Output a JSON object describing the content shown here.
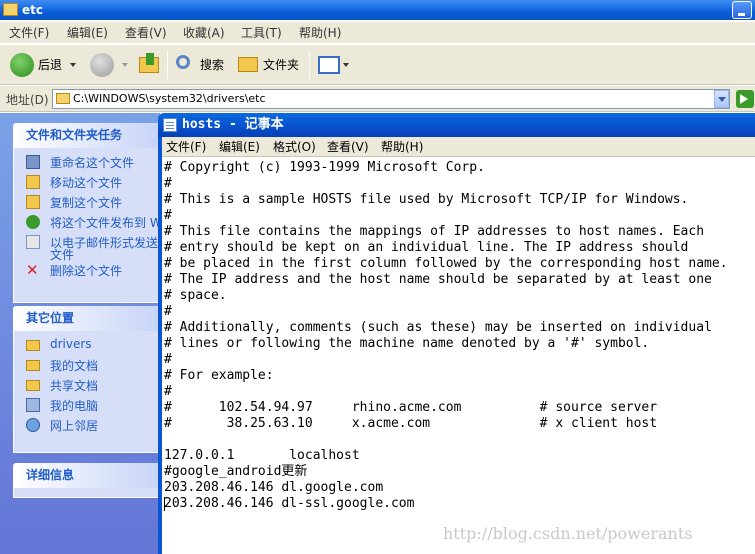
{
  "explorer": {
    "title": "etc",
    "menu": [
      "文件(F)",
      "编辑(E)",
      "查看(V)",
      "收藏(A)",
      "工具(T)",
      "帮助(H)"
    ],
    "toolbar": {
      "back": "后退",
      "search": "搜索",
      "folders": "文件夹"
    },
    "address": {
      "label": "地址(D)",
      "value": "C:\\WINDOWS\\system32\\drivers\\etc"
    }
  },
  "task_pane": {
    "file_tasks": {
      "title": "文件和文件夹任务",
      "items": [
        {
          "label": "重命名这个文件",
          "icon": "rename-icon"
        },
        {
          "label": "移动这个文件",
          "icon": "move-icon"
        },
        {
          "label": "复制这个文件",
          "icon": "copy-icon"
        },
        {
          "label": "将这个文件发布到 W",
          "icon": "publish-web-icon"
        },
        {
          "label": "以电子邮件形式发送",
          "label2": "文件",
          "icon": "email-icon"
        },
        {
          "label": "删除这个文件",
          "icon": "delete-icon"
        }
      ]
    },
    "other_places": {
      "title": "其它位置",
      "items": [
        {
          "label": "drivers",
          "icon": "folder-icon"
        },
        {
          "label": "我的文档",
          "icon": "my-documents-icon"
        },
        {
          "label": "共享文档",
          "icon": "shared-documents-icon"
        },
        {
          "label": "我的电脑",
          "icon": "my-computer-icon"
        },
        {
          "label": "网上邻居",
          "icon": "network-icon"
        }
      ]
    },
    "details": {
      "title": "详细信息"
    }
  },
  "notepad": {
    "title": "hosts - 记事本",
    "menu": [
      "文件(F)",
      "编辑(E)",
      "格式(O)",
      "查看(V)",
      "帮助(H)"
    ],
    "text_lines": [
      "# Copyright (c) 1993-1999 Microsoft Corp.",
      "#",
      "# This is a sample HOSTS file used by Microsoft TCP/IP for Windows.",
      "#",
      "# This file contains the mappings of IP addresses to host names. Each",
      "# entry should be kept on an individual line. The IP address should",
      "# be placed in the first column followed by the corresponding host name.",
      "# The IP address and the host name should be separated by at least one",
      "# space.",
      "#",
      "# Additionally, comments (such as these) may be inserted on individual",
      "# lines or following the machine name denoted by a '#' symbol.",
      "#",
      "# For example:",
      "#",
      "#      102.54.94.97     rhino.acme.com          # source server",
      "#       38.25.63.10     x.acme.com              # x client host",
      "",
      "127.0.0.1       localhost",
      "#google_android更新",
      "203.208.46.146 dl.google.com",
      "203.208.46.146 dl-ssl.google.com"
    ]
  },
  "watermark": "http://blog.csdn.net/powerants"
}
